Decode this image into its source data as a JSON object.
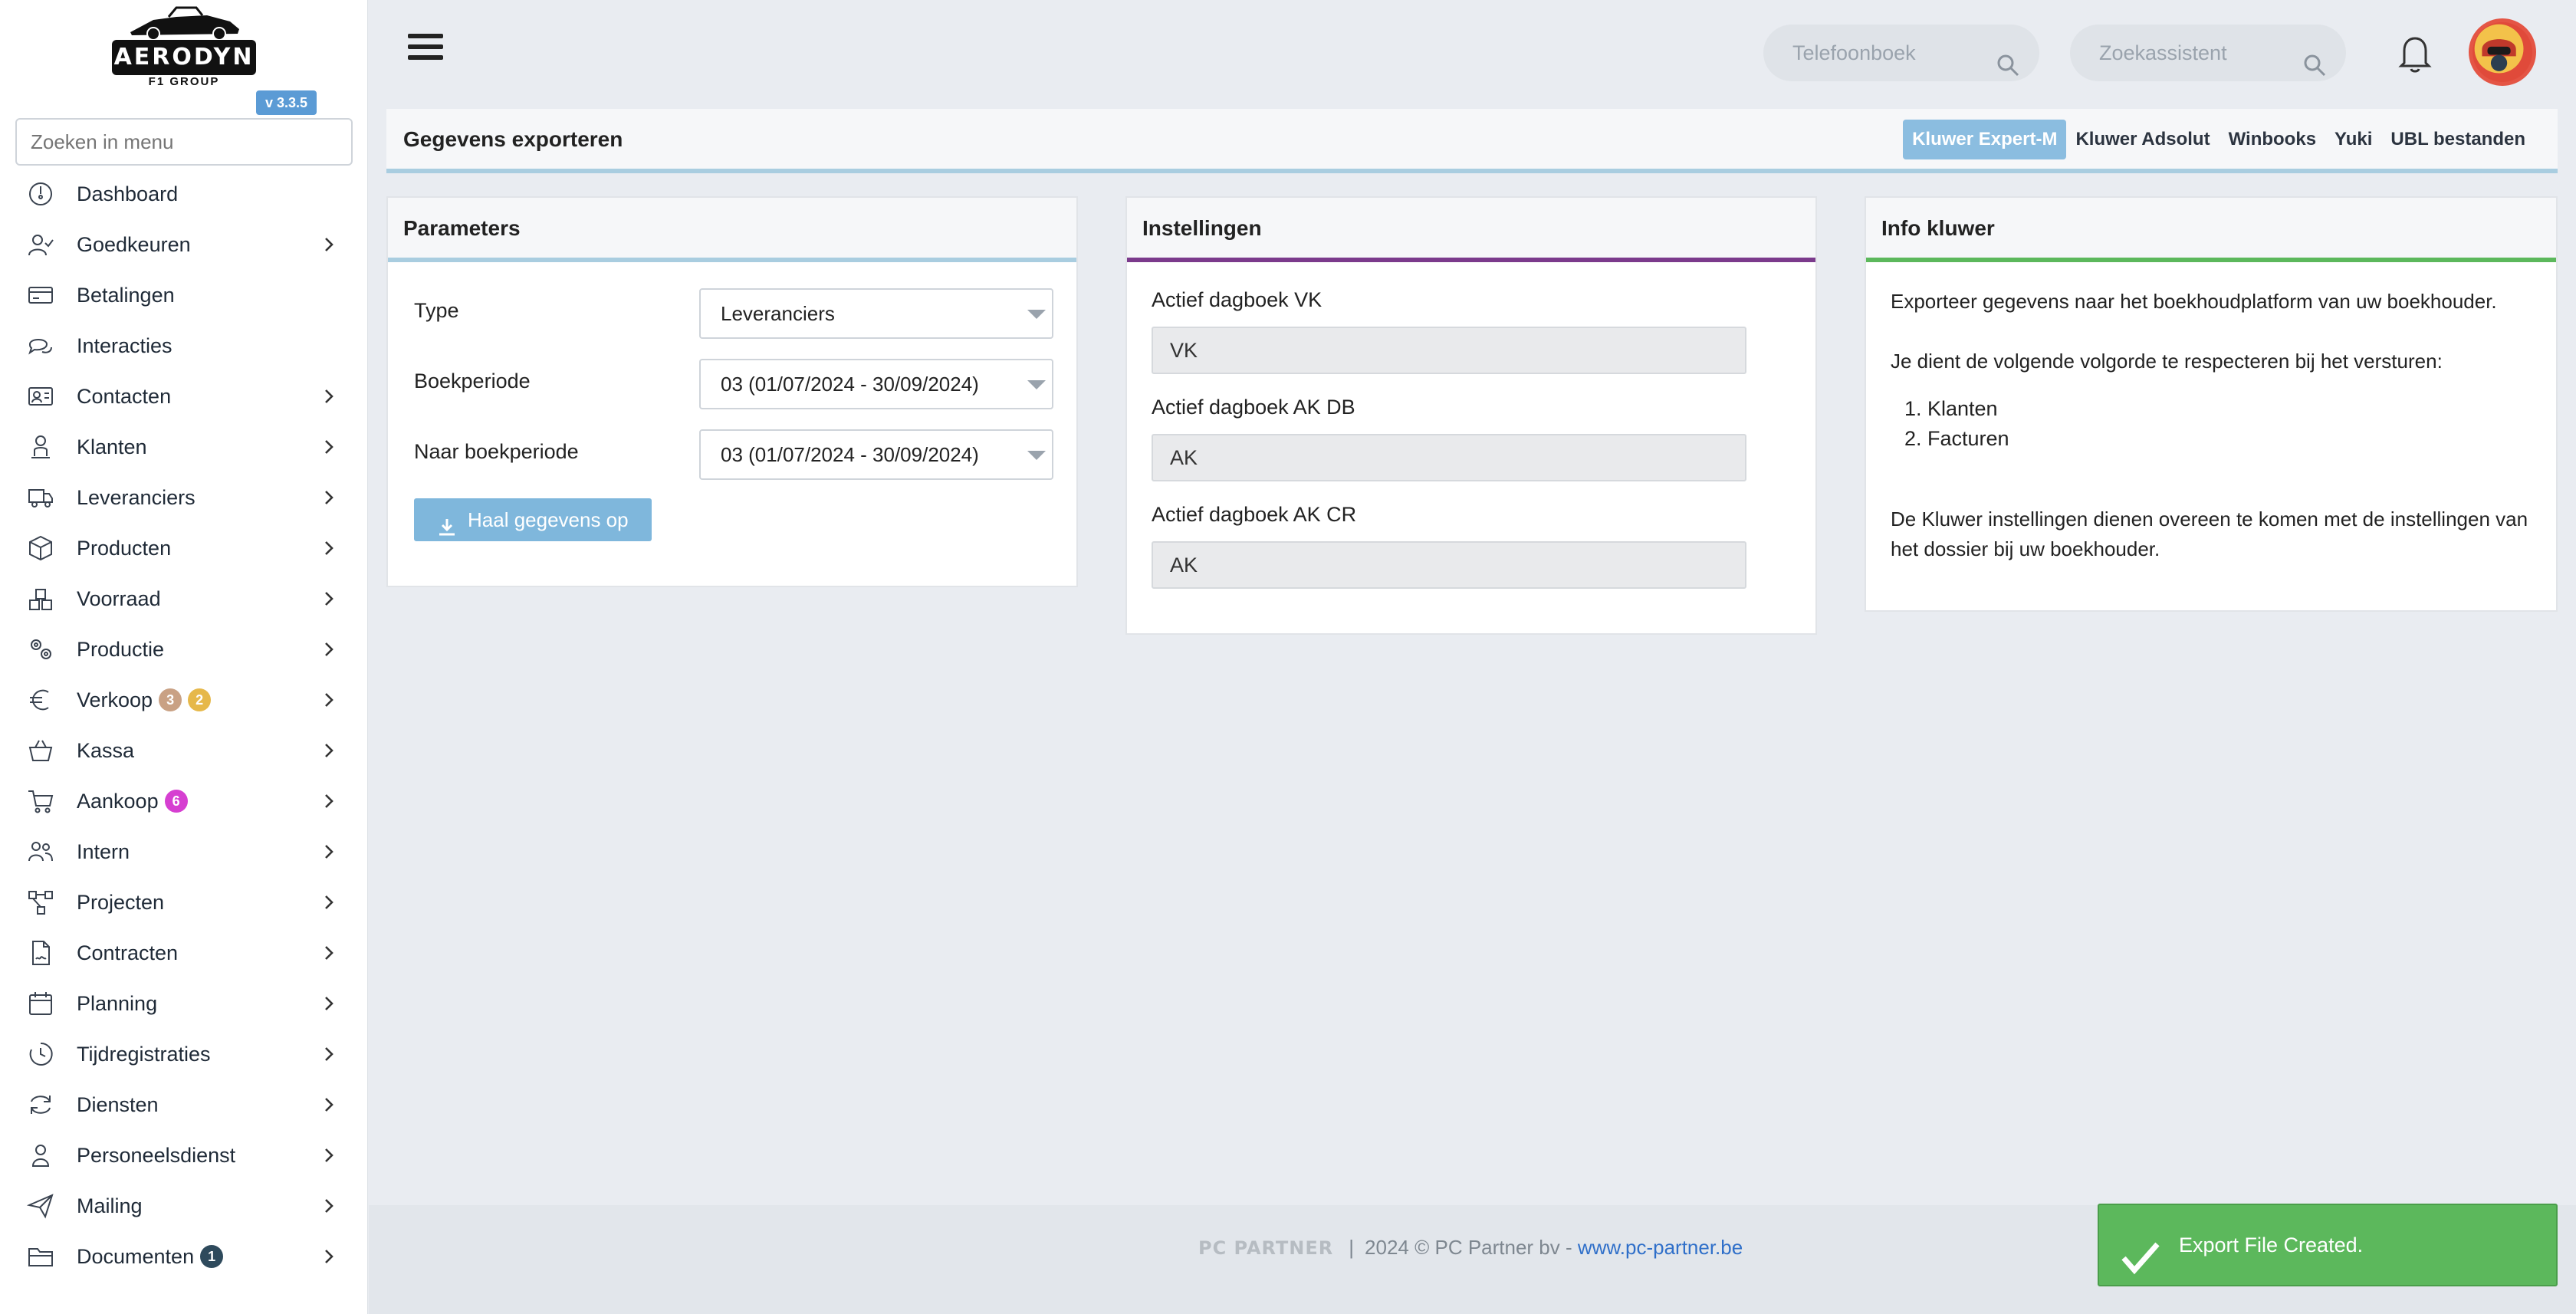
{
  "brand": {
    "logo_text": "AERODYN",
    "logo_sub": "F1 GROUP",
    "version": "v 3.3.5"
  },
  "sidebar": {
    "search_placeholder": "Zoeken in menu",
    "items": [
      {
        "label": "Dashboard",
        "icon": "dashboard-icon",
        "chevron": false
      },
      {
        "label": "Goedkeuren",
        "icon": "user-check-icon",
        "chevron": true
      },
      {
        "label": "Betalingen",
        "icon": "credit-card-icon",
        "chevron": false
      },
      {
        "label": "Interacties",
        "icon": "chat-icon",
        "chevron": false
      },
      {
        "label": "Contacten",
        "icon": "contact-card-icon",
        "chevron": true
      },
      {
        "label": "Klanten",
        "icon": "person-icon",
        "chevron": true
      },
      {
        "label": "Leveranciers",
        "icon": "truck-icon",
        "chevron": true
      },
      {
        "label": "Producten",
        "icon": "box-icon",
        "chevron": true
      },
      {
        "label": "Voorraad",
        "icon": "boxes-icon",
        "chevron": true
      },
      {
        "label": "Productie",
        "icon": "gears-icon",
        "chevron": true
      },
      {
        "label": "Verkoop",
        "icon": "euro-icon",
        "chevron": true,
        "badges": [
          {
            "value": "3",
            "color": "#c9a184"
          },
          {
            "value": "2",
            "color": "#e6b84a"
          }
        ]
      },
      {
        "label": "Kassa",
        "icon": "basket-icon",
        "chevron": true
      },
      {
        "label": "Aankoop",
        "icon": "cart-icon",
        "chevron": true,
        "badges": [
          {
            "value": "6",
            "color": "#d63fd1"
          }
        ]
      },
      {
        "label": "Intern",
        "icon": "users-icon",
        "chevron": true
      },
      {
        "label": "Projecten",
        "icon": "project-icon",
        "chevron": true
      },
      {
        "label": "Contracten",
        "icon": "contract-icon",
        "chevron": true
      },
      {
        "label": "Planning",
        "icon": "calendar-icon",
        "chevron": true
      },
      {
        "label": "Tijdregistraties",
        "icon": "clock-icon",
        "chevron": true
      },
      {
        "label": "Diensten",
        "icon": "refresh-icon",
        "chevron": true
      },
      {
        "label": "Personeelsdienst",
        "icon": "staff-icon",
        "chevron": true
      },
      {
        "label": "Mailing",
        "icon": "send-icon",
        "chevron": true
      },
      {
        "label": "Documenten",
        "icon": "folder-icon",
        "chevron": true,
        "badges": [
          {
            "value": "1",
            "color": "#2e4a5c"
          }
        ]
      }
    ]
  },
  "topbar": {
    "phonebook_placeholder": "Telefoonboek",
    "assistant_placeholder": "Zoekassistent"
  },
  "page": {
    "title": "Gegevens exporteren",
    "tabs": [
      "Kluwer Expert-M",
      "Kluwer Adsolut",
      "Winbooks",
      "Yuki",
      "UBL bestanden"
    ],
    "active_tab": "Kluwer Expert-M"
  },
  "parameters": {
    "title": "Parameters",
    "accent": "#a9cde0",
    "type_label": "Type",
    "type_value": "Leveranciers",
    "period_label": "Boekperiode",
    "period_value": "03 (01/07/2024 - 30/09/2024)",
    "to_period_label": "Naar boekperiode",
    "to_period_value": "03 (01/07/2024 - 30/09/2024)",
    "fetch_button": "Haal gegevens op"
  },
  "settings": {
    "title": "Instellingen",
    "accent": "#7b3a8c",
    "fields": [
      {
        "label": "Actief dagboek VK",
        "value": "VK"
      },
      {
        "label": "Actief dagboek AK DB",
        "value": "AK"
      },
      {
        "label": "Actief dagboek AK CR",
        "value": "AK"
      }
    ]
  },
  "info": {
    "title": "Info kluwer",
    "accent": "#5cb85c",
    "intro": "Exporteer gegevens naar het boekhoudplatform van uw boekhouder.",
    "order_text": "Je dient de volgende volgorde te respecteren bij het versturen:",
    "order": [
      "Klanten",
      "Facturen"
    ],
    "note_line1": "De Kluwer instellingen dienen overeen te komen met de instellingen van",
    "note_line2": "het dossier bij uw boekhouder."
  },
  "footer": {
    "logo": "PC PARTNER",
    "text": "2024 © PC Partner bv - ",
    "link": "www.pc-partner.be"
  },
  "toast": {
    "message": "Export File Created.",
    "color": "#5cb85c"
  }
}
